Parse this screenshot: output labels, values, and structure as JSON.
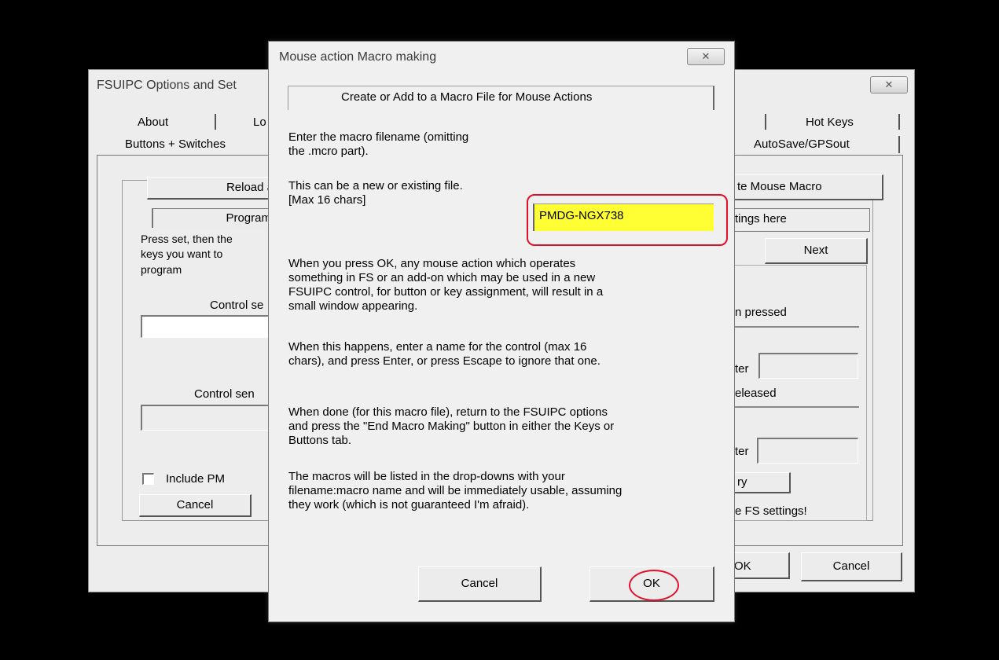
{
  "bg_window": {
    "title": "FSUIPC Options and Set",
    "close_glyph": "✕",
    "tabs_left": [
      "About",
      "Lo",
      "Buttons + Switches"
    ],
    "tabs_right": [
      "Hot Keys",
      "AutoSave/GPSout"
    ],
    "reload_label": "Reload a",
    "program_label": "Program",
    "press_set_text": [
      "Press set, then the",
      "keys you want to",
      "program"
    ],
    "control_sent_1": "Control se",
    "control_sent_2": "Control sen",
    "include_pm_label": "Include PM",
    "cancel_left": "Cancel",
    "create_mouse_macro": "te Mouse Macro",
    "settings_here": "tings here",
    "next_label": "Next",
    "n_pressed": "n pressed",
    "ter_1": "ter",
    "eleased": "eleased",
    "ter_2": "ter",
    "ry_label": "ry",
    "fs_settings": "e FS settings!",
    "ok_label": "OK",
    "cancel_right": "Cancel"
  },
  "dialog": {
    "title": "Mouse action Macro making",
    "close_glyph": "✕",
    "heading": "Create or Add to a Macro File for Mouse Actions",
    "enter_filename": [
      "Enter the macro filename (omitting",
      "the .mcro part)."
    ],
    "new_or_existing": [
      "This can be a new or existing file.",
      "[Max 16 chars]"
    ],
    "filename_value": "PMDG-NGX738",
    "para_ok": [
      "When you press OK, any mouse action which operates",
      "something in FS or an add-on which may be used in a new",
      "FSUIPC control, for button or key assignment, will result in a",
      "small window appearing."
    ],
    "para_happens": [
      "When this happens, enter a name for the control (max 16",
      "chars), and press Enter, or press Escape to ignore that one."
    ],
    "para_done": [
      "When done (for this macro file), return to the FSUIPC options",
      "and press the \"End Macro Making\" button in either the Keys or",
      "Buttons tab."
    ],
    "para_listed": [
      "The macros will be listed in the drop-downs with your",
      "filename:macro name and will be immediately usable, assuming",
      "they work (which is not guaranteed I'm afraid)."
    ],
    "cancel_label": "Cancel",
    "ok_label": "OK"
  },
  "colors": {
    "highlight": "#ffff33",
    "annotation": "#e0102a"
  }
}
